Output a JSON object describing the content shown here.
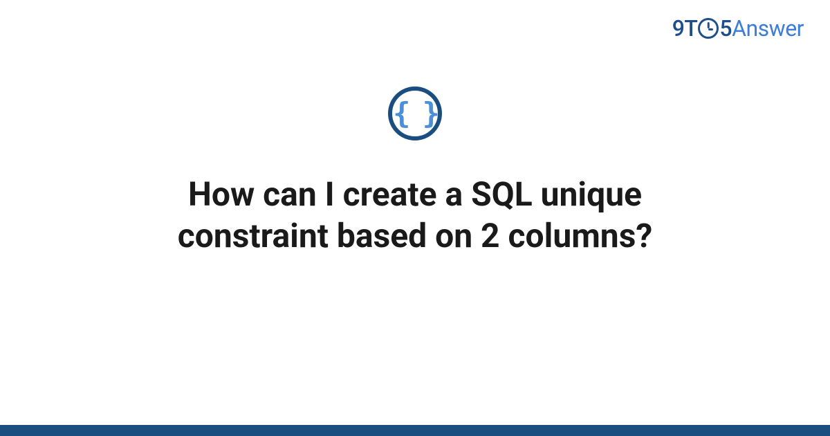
{
  "brand": {
    "part1": "9T",
    "part2": "5",
    "part3": "Answer"
  },
  "icon": {
    "glyph": "{ }"
  },
  "title": "How can I create a SQL unique constraint based on 2 columns?"
}
